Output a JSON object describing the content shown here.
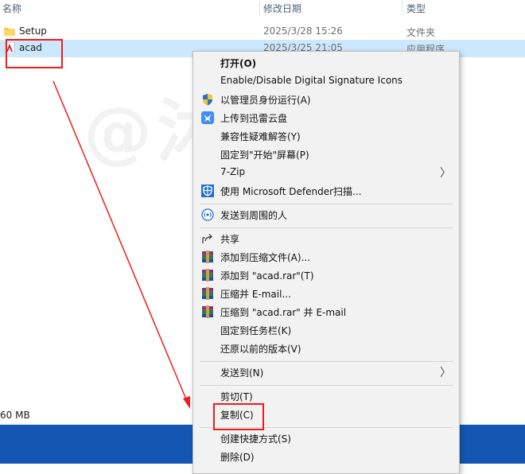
{
  "header": {
    "name_col": "名称",
    "date_col": "修改日期",
    "type_col": "类型"
  },
  "files": [
    {
      "name": "Setup",
      "date": "2025/3/28 15:26",
      "type": "文件夹",
      "icon": "folder-icon"
    },
    {
      "name": "acad",
      "date": "2025/3/25 21:05",
      "type": "应用程序",
      "icon": "autocad-icon",
      "selected": true
    }
  ],
  "status": {
    "size": "60 MB"
  },
  "watermark": "@沐子风",
  "context_menu": {
    "open": "打开(O)",
    "sig_icons": "Enable/Disable Digital Signature Icons",
    "run_admin": "以管理员身份运行(A)",
    "upload_xunlei": "上传到迅雷云盘",
    "compat": "兼容性疑难解答(Y)",
    "pin_start": "固定到\"开始\"屏幕(P)",
    "zip7": "7-Zip",
    "defender": "使用 Microsoft Defender扫描...",
    "nearby": "发送到周围的人",
    "share": "共享",
    "add_archive": "添加到压缩文件(A)...",
    "add_rar": "添加到 \"acad.rar\"(T)",
    "compress_email": "压缩并 E-mail...",
    "compress_rar_email": "压缩到 \"acad.rar\" 并 E-mail",
    "pin_taskbar": "固定到任务栏(K)",
    "restore": "还原以前的版本(V)",
    "send_to": "发送到(N)",
    "cut": "剪切(T)",
    "copy": "复制(C)",
    "shortcut": "创建快捷方式(S)",
    "delete": "删除(D)"
  },
  "colors": {
    "selection": "#cce8ff",
    "taskbar": "#1457b2",
    "annotation": "#ee1c1c",
    "menu_bg": "#f2f2f2"
  }
}
